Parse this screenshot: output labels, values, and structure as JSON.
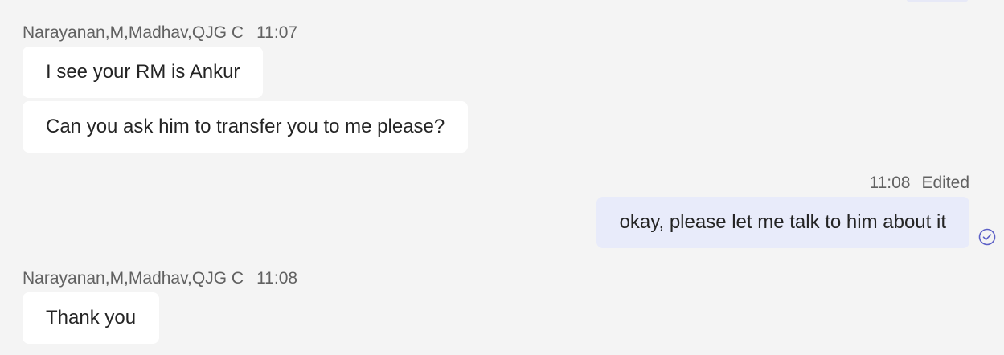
{
  "conversation": {
    "messages": [
      {
        "sender": "Narayanan,M,Madhav,QJG C",
        "time": "11:07",
        "lines": [
          "I see your RM is Ankur",
          "Can you ask him to transfer you to me please?"
        ]
      },
      {
        "time": "11:08",
        "edited_label": "Edited",
        "lines": [
          "okay, please let me talk to him about it"
        ],
        "status_icon": "sent-check-icon"
      },
      {
        "sender": "Narayanan,M,Madhav,QJG C",
        "time": "11:08",
        "lines": [
          "Thank you"
        ]
      }
    ]
  },
  "colors": {
    "background": "#f4f4f4",
    "incoming_bubble": "#ffffff",
    "outgoing_bubble": "#e8ebfa",
    "meta_text": "#616161",
    "accent": "#5b5fc7"
  }
}
